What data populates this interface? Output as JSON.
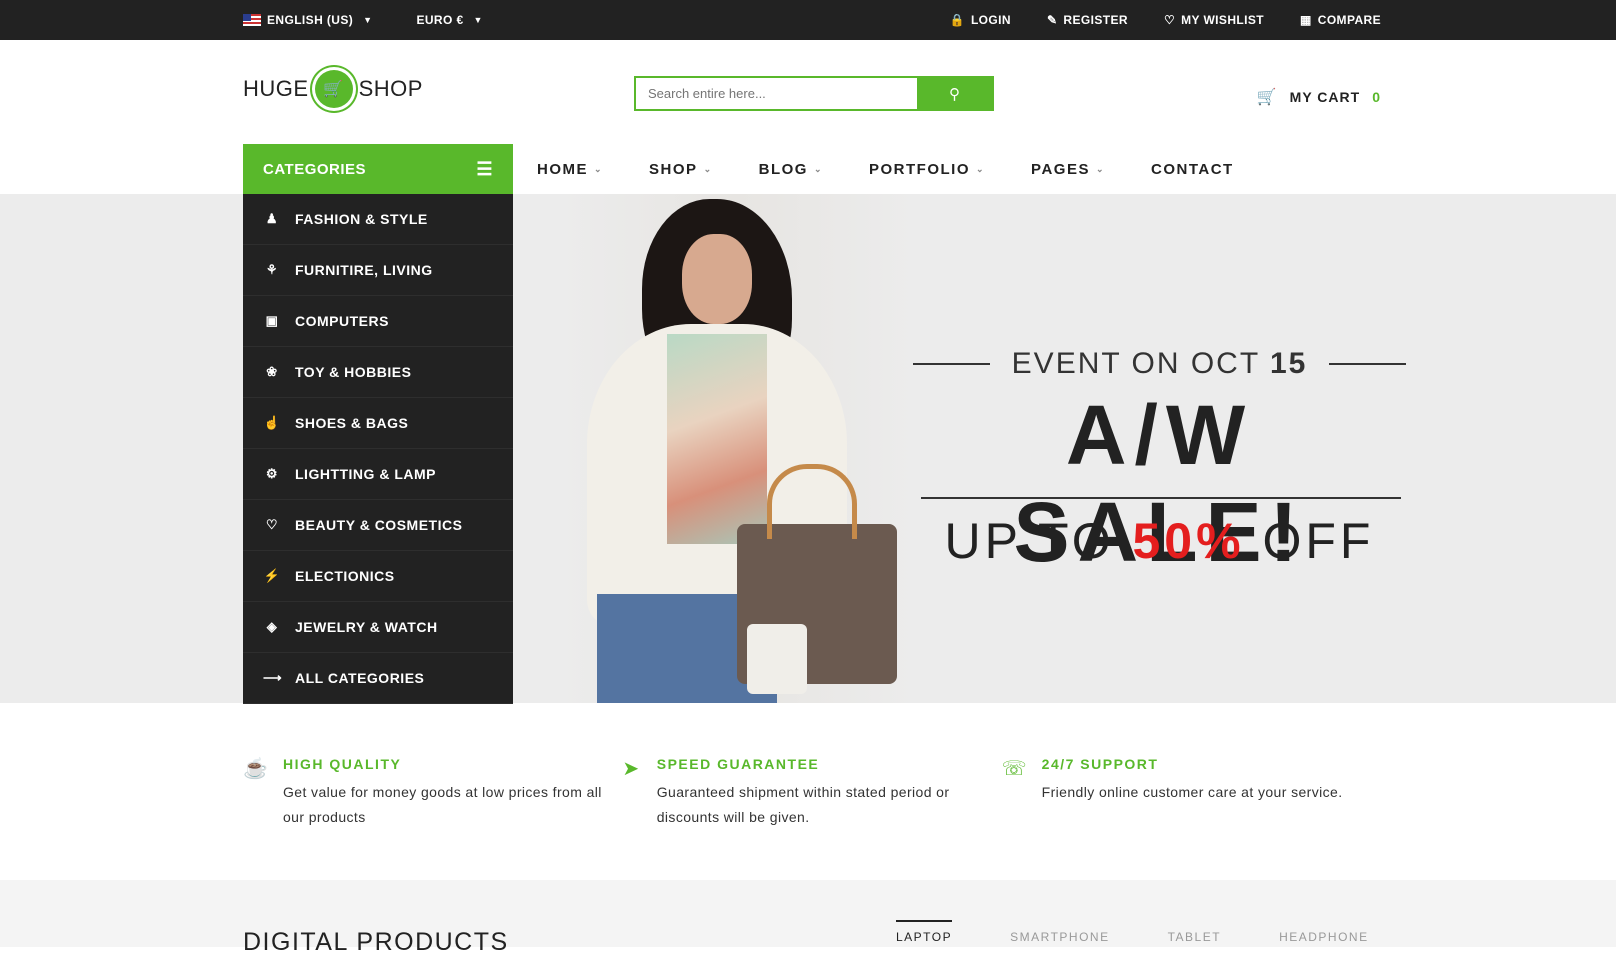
{
  "topbar": {
    "language": "ENGLISH (US)",
    "currency": "EURO €",
    "login": "LOGIN",
    "register": "REGISTER",
    "wishlist": "MY WISHLIST",
    "compare": "COMPARE"
  },
  "header": {
    "logo_left": "HUGE",
    "logo_right": "SHOP",
    "search_placeholder": "Search entire here...",
    "cart_label": "MY CART",
    "cart_count": "0"
  },
  "categories": {
    "title": "CATEGORIES",
    "items": [
      {
        "label": "FASHION & STYLE",
        "icon": "person-icon"
      },
      {
        "label": "FURNITIRE, LIVING",
        "icon": "plant-icon"
      },
      {
        "label": "COMPUTERS",
        "icon": "laptop-icon"
      },
      {
        "label": "TOY & HOBBIES",
        "icon": "paw-icon"
      },
      {
        "label": "SHOES & BAGS",
        "icon": "thumbs-up-icon"
      },
      {
        "label": "LIGHTTING & LAMP",
        "icon": "gear-icon"
      },
      {
        "label": "BEAUTY & COSMETICS",
        "icon": "heart-icon"
      },
      {
        "label": "ELECTIONICS",
        "icon": "bolt-icon"
      },
      {
        "label": "JEWELRY & WATCH",
        "icon": "diamond-icon"
      },
      {
        "label": "ALL CATEGORIES",
        "icon": "arrow-right-icon"
      }
    ]
  },
  "nav": {
    "items": [
      "HOME",
      "SHOP",
      "BLOG",
      "PORTFOLIO",
      "PAGES",
      "CONTACT"
    ]
  },
  "hero": {
    "event_prefix": "EVENT ON OCT",
    "event_day": "15",
    "sale": "A/W SALE!",
    "upto_prefix": "UP TO",
    "upto_percent": "50%",
    "upto_suffix": "OFF"
  },
  "features": [
    {
      "title": "HIGH QUALITY",
      "text": "Get value for money goods at low prices from all our products",
      "icon": "cup-icon"
    },
    {
      "title": "SPEED GUARANTEE",
      "text": "Guaranteed shipment within stated period or discounts will be given.",
      "icon": "rocket-icon"
    },
    {
      "title": "24/7 SUPPORT",
      "text": "Friendly online customer care at your service.",
      "icon": "headphones-icon"
    }
  ],
  "digital": {
    "title": "DIGITAL PRODUCTS",
    "tabs": [
      "LAPTOP",
      "SMARTPHONE",
      "TABLET",
      "HEADPHONE"
    ]
  },
  "colors": {
    "accent": "#59b82b",
    "dark": "#222222",
    "sale_red": "#e41e1e"
  }
}
